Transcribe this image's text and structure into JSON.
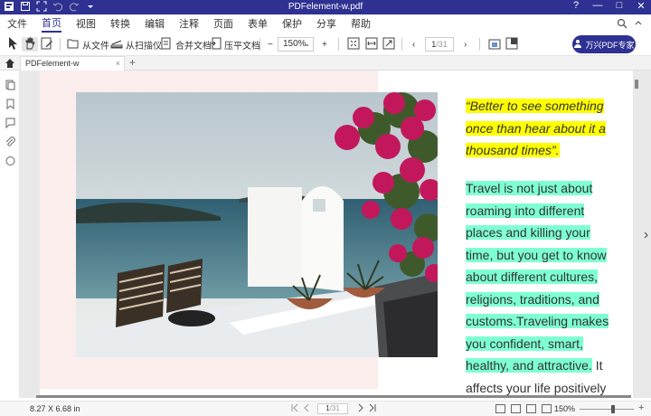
{
  "titlebar": {
    "title": "PDFelement-w.pdf",
    "window_controls": [
      "?",
      "—",
      "□",
      "✕"
    ]
  },
  "menubar": {
    "items": [
      "文件",
      "首页",
      "视图",
      "转换",
      "编辑",
      "注释",
      "页面",
      "表单",
      "保护",
      "分享",
      "帮助"
    ],
    "active_index": 1
  },
  "toolbar": {
    "from_file": "从文件",
    "from_scanner": "从扫描仪",
    "combine": "合并文档",
    "flatten": "压平文档",
    "zoom_out": "−",
    "zoom_value": "150%",
    "zoom_in": "+",
    "prev_page": "‹",
    "page_input": "1",
    "page_total": "/31",
    "next_page": "›",
    "login_label": "万兴PDF专家"
  },
  "tabs": {
    "document_tab": "PDFelement-w",
    "close": "×",
    "add": "+"
  },
  "document": {
    "quote_lines": [
      "“Better to see something",
      "once than hear about it a",
      "thousand times”."
    ],
    "body_lines": [
      "Travel is not just about",
      "roaming into different",
      "places and killing your",
      "time, but you get to know",
      "about different cultures,",
      "religions, traditions, and",
      "customs.Traveling makes",
      "you confident, smart,",
      "healthy, and attractive."
    ],
    "body_tail_a": " It",
    "body_tail_b": "affects your life positively"
  },
  "statusbar": {
    "dimensions": "8.27 X 6.68 in",
    "page_input": "1",
    "page_total": "/31",
    "zoom": "150%"
  },
  "colors": {
    "brand": "#2e3192",
    "quote_highlight": "#ffff00",
    "body_highlight": "#7fffd4",
    "pink_background": "#fbeeed"
  }
}
